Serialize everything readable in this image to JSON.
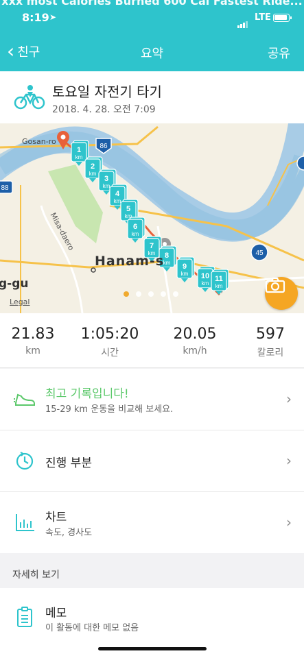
{
  "banner": "xxx most Calories Burned 600 Cal Fastest Ride...",
  "status_bar": {
    "time": "8:19",
    "network": "LTE"
  },
  "nav": {
    "back_label": "친구",
    "title": "요약",
    "share_label": "공유"
  },
  "activity": {
    "title": "토요일 자전기 타기",
    "datetime": "2018. 4. 28. 오전 7:09"
  },
  "map": {
    "labels": {
      "road_gosan": "Gosan-ro",
      "road_misa": "Misa-daero",
      "city": "Hanam-s",
      "gu": "g-gu",
      "legal": "Legal"
    },
    "route_shields": [
      "86",
      "88",
      "45"
    ],
    "km_markers": [
      "1",
      "2",
      "3",
      "4",
      "5",
      "6",
      "7",
      "8",
      "9",
      "10",
      "11"
    ],
    "km_unit": "km",
    "page_count": 5,
    "active_page": 0
  },
  "stats": [
    {
      "value": "21.83",
      "unit": "km"
    },
    {
      "value": "1:05:20",
      "unit": "시간"
    },
    {
      "value": "20.05",
      "unit": "km/h"
    },
    {
      "value": "597",
      "unit": "칼로리"
    }
  ],
  "best_record": {
    "title": "최고 기록입니다!",
    "subtitle": "15-29 km 운동을 비교해 보세요."
  },
  "progress": {
    "title": "진행 부분"
  },
  "chart": {
    "title": "차트",
    "subtitle": "속도, 경사도"
  },
  "details_section": {
    "title": "자세히 보기"
  },
  "memo": {
    "title": "메모",
    "subtitle": "이 활동에 대한 메모 없음"
  },
  "colors": {
    "accent": "#2ec4cc",
    "highlight": "#5bc86a",
    "route": "#e8613a",
    "camera": "#f5a623"
  }
}
